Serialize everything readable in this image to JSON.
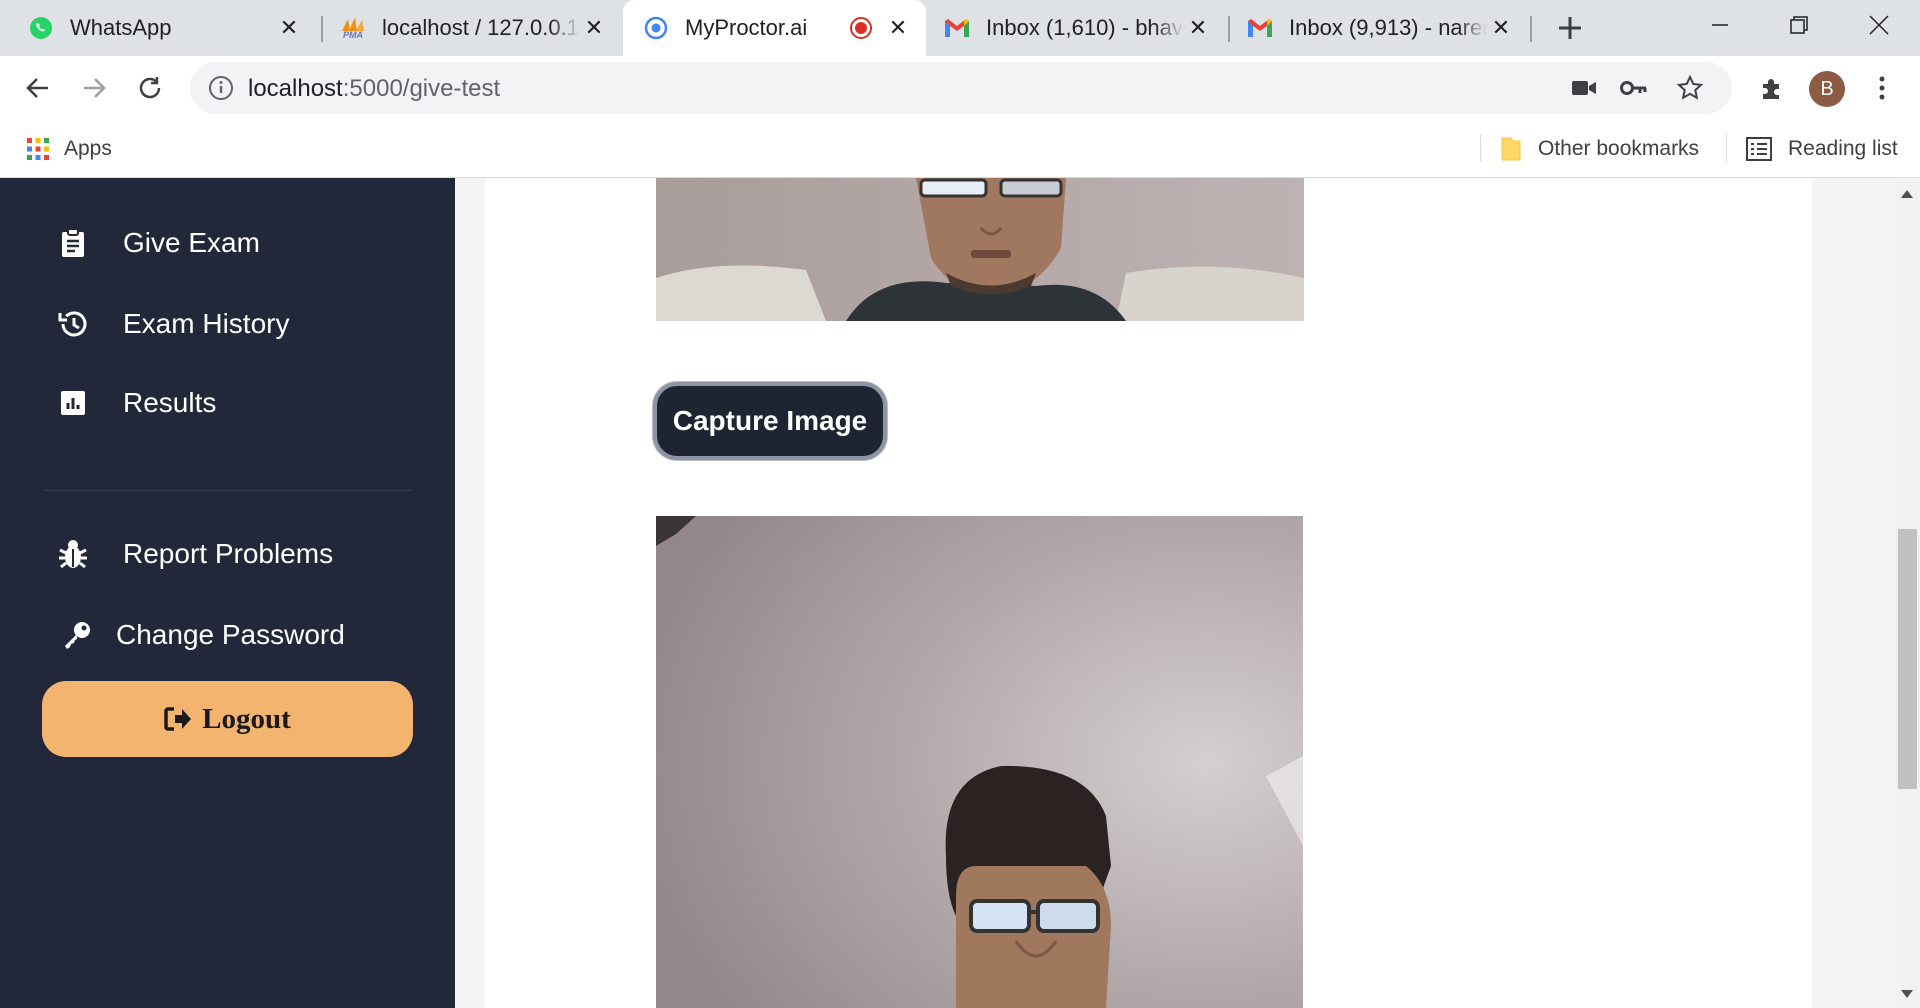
{
  "browser": {
    "tabs": [
      {
        "title": "WhatsApp",
        "icon": "whatsapp-icon"
      },
      {
        "title": "localhost / 127.0.0.1",
        "icon": "phpmyadmin-icon",
        "icon_text": "PMA"
      },
      {
        "title": "MyProctor.ai",
        "icon": "chrome-icon",
        "active": true,
        "recording": true
      },
      {
        "title": "Inbox (1,610) - bhavi",
        "icon": "gmail-icon"
      },
      {
        "title": "Inbox (9,913) - naren",
        "icon": "gmail-icon"
      }
    ],
    "url": {
      "host": "localhost",
      "path": ":5000/give-test"
    },
    "profile_initial": "B",
    "bookmarks": {
      "apps": "Apps",
      "other": "Other bookmarks",
      "reading_list": "Reading list"
    },
    "colors": {
      "tabstrip": "#dee1e6",
      "omnibox": "#f1f3f4"
    }
  },
  "sidebar": {
    "items": [
      {
        "label": "Give Exam",
        "icon": "clipboard-icon"
      },
      {
        "label": "Exam History",
        "icon": "history-icon"
      },
      {
        "label": "Results",
        "icon": "chart-icon"
      },
      {
        "label": "Report Problems",
        "icon": "bug-icon"
      },
      {
        "label": "Change Password",
        "icon": "key-icon"
      }
    ],
    "logout_label": "Logout",
    "colors": {
      "background": "#222839",
      "logout": "#f2b46e"
    }
  },
  "main": {
    "capture_button": "Capture Image",
    "webcam_feeds": [
      "webcam-preview",
      "captured-image"
    ]
  }
}
